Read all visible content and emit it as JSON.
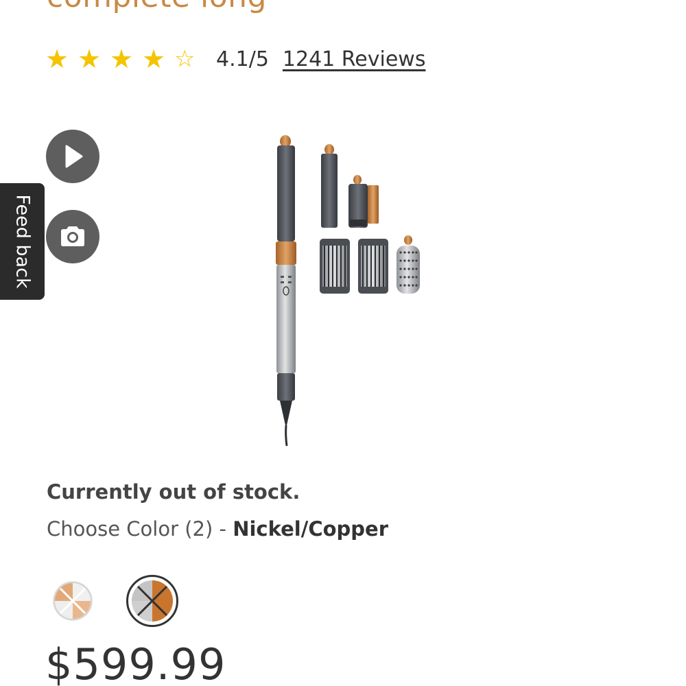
{
  "product": {
    "title": "complete long",
    "rating": {
      "score": "4.1/5",
      "value": 4.1,
      "max": 5,
      "reviews_label": "1241 Reviews"
    },
    "stock_status": "Currently out of stock.",
    "color": {
      "choose_label": "Choose Color (2) - ",
      "selected": "Nickel/Copper"
    },
    "price": "$599.99"
  },
  "stars": [
    "★",
    "★",
    "★",
    "★",
    "☆"
  ],
  "feedback": {
    "label": "Feed back"
  },
  "colors": {
    "title_copper": "#c98945",
    "star": "#f4c400",
    "button_gray": "#5e5e5e",
    "feedback_bg": "#2b2b2b"
  },
  "icons": [
    "play-icon",
    "camera-icon"
  ]
}
